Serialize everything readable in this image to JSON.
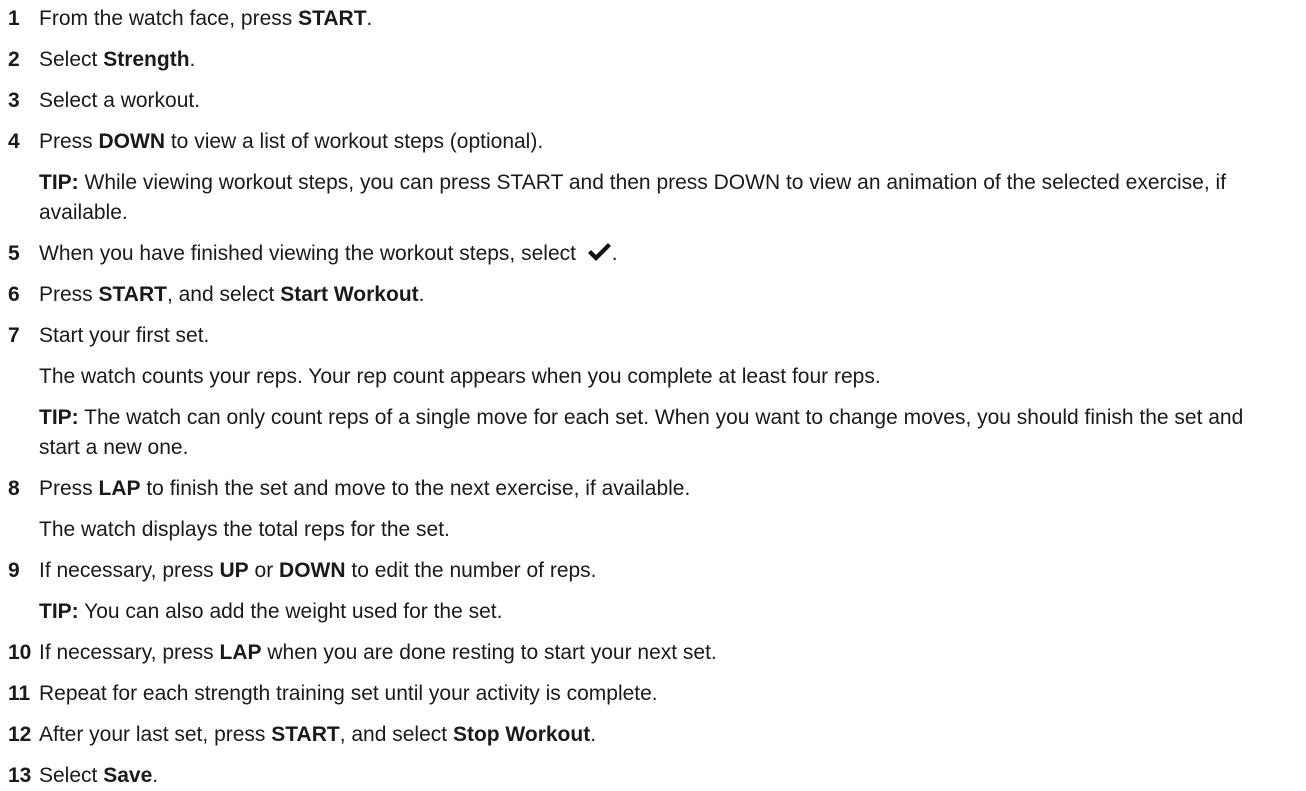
{
  "steps": [
    {
      "num": "1",
      "parts": [
        {
          "t": "From the watch face, press "
        },
        {
          "b": "START"
        },
        {
          "t": "."
        }
      ]
    },
    {
      "num": "2",
      "parts": [
        {
          "t": "Select "
        },
        {
          "b": "Strength"
        },
        {
          "t": "."
        }
      ]
    },
    {
      "num": "3",
      "parts": [
        {
          "t": "Select a workout."
        }
      ]
    },
    {
      "num": "4",
      "parts": [
        {
          "t": "Press "
        },
        {
          "b": "DOWN"
        },
        {
          "t": " to view a list of workout steps (optional)."
        }
      ],
      "tip": {
        "label": "TIP:",
        "text": " While viewing workout steps, you can press START and then press DOWN to view an animation of the selected exercise, if available."
      }
    },
    {
      "num": "5",
      "parts": [
        {
          "t": "When you have finished viewing the workout steps, select "
        }
      ],
      "icon": "check-icon",
      "after": "."
    },
    {
      "num": "6",
      "parts": [
        {
          "t": "Press "
        },
        {
          "b": "START"
        },
        {
          "t": ", and select "
        },
        {
          "b": "Start Workout"
        },
        {
          "t": "."
        }
      ]
    },
    {
      "num": "7",
      "parts": [
        {
          "t": "Start your first set."
        }
      ],
      "cont": "The watch counts your reps. Your rep count appears when you complete at least four reps.",
      "tip": {
        "label": "TIP:",
        "text": " The watch can only count reps of a single move for each set. When you want to change moves, you should finish the set and start a new one."
      }
    },
    {
      "num": "8",
      "parts": [
        {
          "t": "Press "
        },
        {
          "b": "LAP"
        },
        {
          "t": " to finish the set and move to the next exercise, if available."
        }
      ],
      "cont": "The watch displays the total reps for the set."
    },
    {
      "num": "9",
      "parts": [
        {
          "t": "If necessary, press "
        },
        {
          "b": "UP"
        },
        {
          "t": " or "
        },
        {
          "b": "DOWN"
        },
        {
          "t": " to edit the number of reps."
        }
      ],
      "tip": {
        "label": "TIP:",
        "text": " You can also add the weight used for the set."
      }
    },
    {
      "num": "10",
      "parts": [
        {
          "t": "If necessary, press "
        },
        {
          "b": "LAP"
        },
        {
          "t": " when you are done resting to start your next set."
        }
      ]
    },
    {
      "num": "11",
      "parts": [
        {
          "t": "Repeat for each strength training set until your activity is complete."
        }
      ]
    },
    {
      "num": "12",
      "parts": [
        {
          "t": "After your last set, press "
        },
        {
          "b": "START"
        },
        {
          "t": ", and select "
        },
        {
          "b": "Stop Workout"
        },
        {
          "t": "."
        }
      ]
    },
    {
      "num": "13",
      "parts": [
        {
          "t": "Select "
        },
        {
          "b": "Save"
        },
        {
          "t": "."
        }
      ]
    }
  ]
}
